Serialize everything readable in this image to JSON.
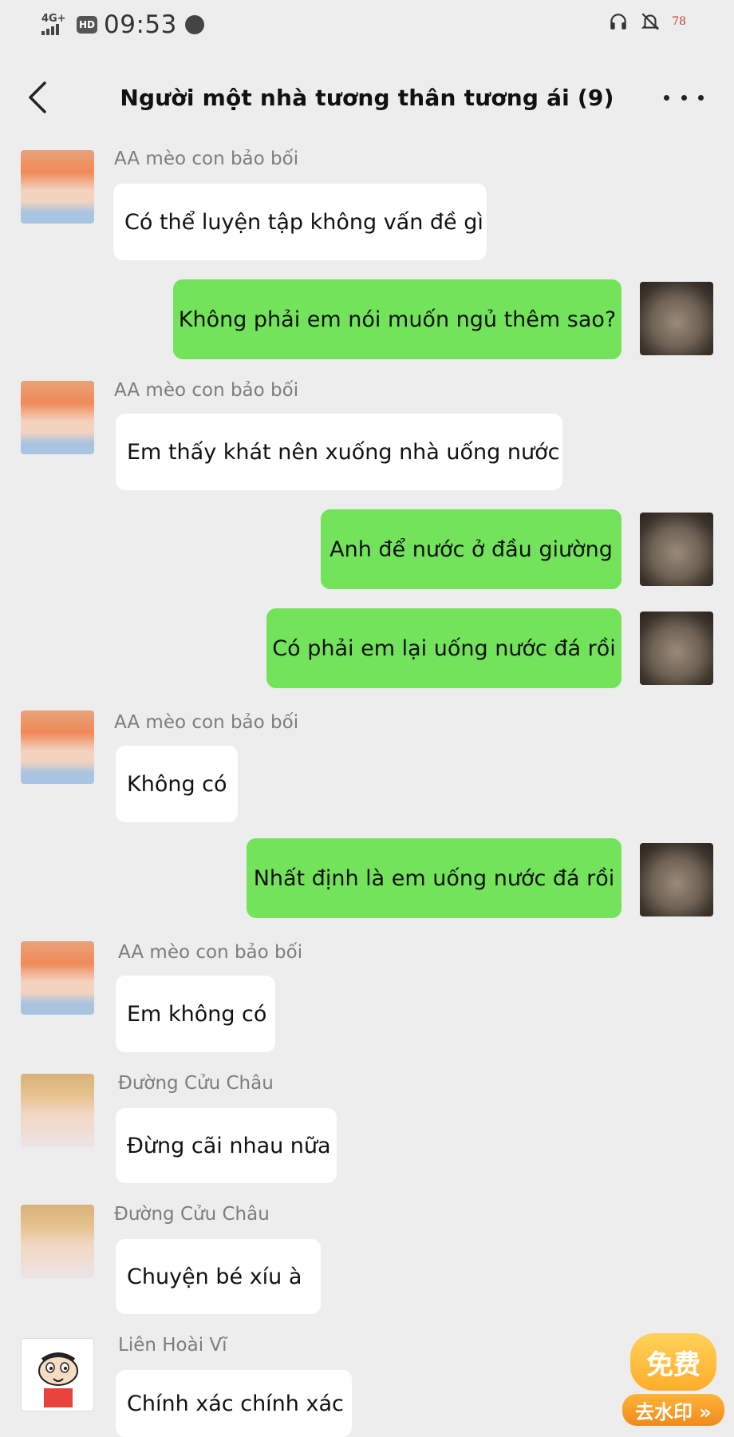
{
  "status_bar": {
    "network": "4G+",
    "hd": "HD",
    "time": "09:53",
    "battery": "78"
  },
  "header": {
    "title": "Người một nhà tương thân tương ái (9)"
  },
  "messages": [
    {
      "side": "in",
      "sender": "AA mèo con bảo bối",
      "text": "Có thể luyện tập không vấn đề gì",
      "avatar": "orange-hair-boy"
    },
    {
      "side": "out",
      "text": "Không phải em nói muốn ngủ thêm sao?",
      "avatar": "cat"
    },
    {
      "side": "in",
      "sender": "AA mèo con bảo bối",
      "text": "Em thấy khát nên xuống nhà uống nước",
      "avatar": "orange-hair-boy"
    },
    {
      "side": "out",
      "text": "Anh để nước ở đầu giường",
      "avatar": "cat"
    },
    {
      "side": "out",
      "text": "Có phải em lại uống nước đá rồi",
      "avatar": "cat"
    },
    {
      "side": "in",
      "sender": "AA mèo con bảo bối",
      "text": "Không có",
      "avatar": "orange-hair-boy"
    },
    {
      "side": "out",
      "text": "Nhất định là em uống nước đá rồi",
      "avatar": "cat"
    },
    {
      "side": "in",
      "sender": "AA mèo con bảo bối",
      "text": "Em không có",
      "avatar": "orange-hair-boy"
    },
    {
      "side": "in",
      "sender": "Đường Cửu Châu",
      "text": "Đừng cãi nhau nữa",
      "avatar": "blond-boy"
    },
    {
      "side": "in",
      "sender": "Đường Cửu Châu",
      "text": "Chuyện bé xíu à",
      "avatar": "blond-boy"
    },
    {
      "side": "in",
      "sender": "Liên Hoài Vĩ",
      "text": "Chính xác chính xác",
      "avatar": "cartoon"
    }
  ],
  "promo": {
    "top": "免费",
    "bottom": "去水印 »"
  }
}
